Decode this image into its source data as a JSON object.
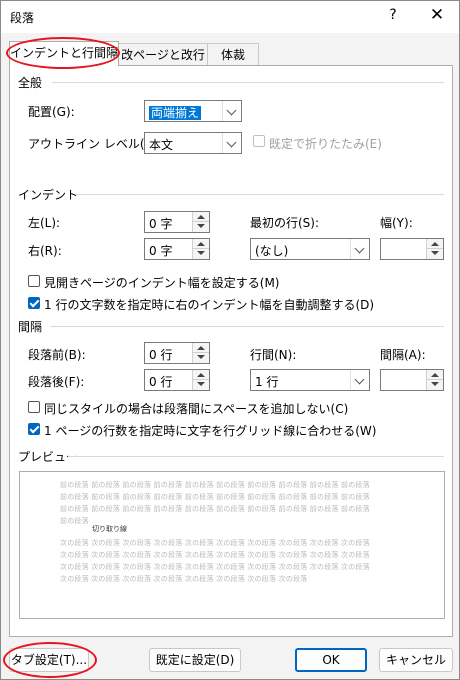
{
  "window": {
    "title": "段落",
    "help": "?",
    "close": "✕"
  },
  "tabs": [
    {
      "label": "インデントと行間隔"
    },
    {
      "label": "改ページと改行"
    },
    {
      "label": "体裁"
    }
  ],
  "general": {
    "heading": "全般",
    "alignment_label": "配置(G):",
    "alignment_value": "両端揃え",
    "outline_label": "アウトライン レベル(O):",
    "outline_value": "本文",
    "collapse_label": "既定で折りたたみ(E)"
  },
  "indent": {
    "heading": "インデント",
    "left_label": "左(L):",
    "left_value": "0 字",
    "right_label": "右(R):",
    "right_value": "0 字",
    "first_line_label": "最初の行(S):",
    "first_line_value": "(なし)",
    "width_label": "幅(Y):",
    "width_value": "",
    "mirror_label": "見開きページのインデント幅を設定する(M)",
    "auto_adjust_label": "1 行の文字数を指定時に右のインデント幅を自動調整する(D)"
  },
  "spacing": {
    "heading": "間隔",
    "before_label": "段落前(B):",
    "before_value": "0 行",
    "after_label": "段落後(F):",
    "after_value": "0 行",
    "line_spacing_label": "行間(N):",
    "line_spacing_value": "1 行",
    "at_label": "間隔(A):",
    "at_value": "",
    "no_space_label": "同じスタイルの場合は段落間にスペースを追加しない(C)",
    "snap_grid_label": "1 ページの行数を指定時に文字を行グリッド線に合わせる(W)"
  },
  "preview": {
    "heading": "プレビュー",
    "prev_lines": [
      "前の段落 前の段落 前の段落 前の段落 前の段落 前の段落 前の段落 前の段落 前の段落 前の段落",
      "前の段落 前の段落 前の段落 前の段落 前の段落 前の段落 前の段落 前の段落 前の段落 前の段落",
      "前の段落 前の段落 前の段落 前の段落 前の段落 前の段落 前の段落 前の段落 前の段落 前の段落",
      "前の段落"
    ],
    "current_line": "切り取り線",
    "next_lines": [
      "次の段落 次の段落 次の段落 次の段落 次の段落 次の段落 次の段落 次の段落 次の段落 次の段落",
      "次の段落 次の段落 次の段落 次の段落 次の段落 次の段落 次の段落 次の段落 次の段落 次の段落",
      "次の段落 次の段落 次の段落 次の段落 次の段落 次の段落 次の段落 次の段落 次の段落 次の段落",
      "次の段落 次の段落 次の段落 次の段落 次の段落 次の段落 次の段落 次の段落"
    ]
  },
  "buttons": {
    "tabs": "タブ設定(T)...",
    "default": "既定に設定(D)",
    "ok": "OK",
    "cancel": "キャンセル"
  },
  "colors": {
    "accent": "#0067c0",
    "highlight": "#e8141d"
  }
}
